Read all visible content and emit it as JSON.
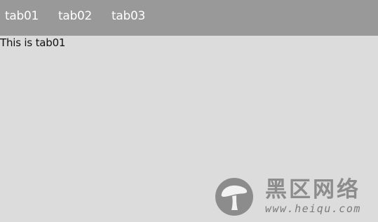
{
  "tabs": [
    {
      "label": "tab01"
    },
    {
      "label": "tab02"
    },
    {
      "label": "tab03"
    }
  ],
  "content": {
    "text": "This is tab01"
  },
  "watermark": {
    "title": "黑区网络",
    "url": "www.heiqu.com",
    "logo_icon": "mushroom-icon"
  },
  "colors": {
    "tabbar_background": "#999999",
    "page_background": "#dcdcdc",
    "tab_text": "#ffffff",
    "watermark": "#8c8c8c"
  }
}
